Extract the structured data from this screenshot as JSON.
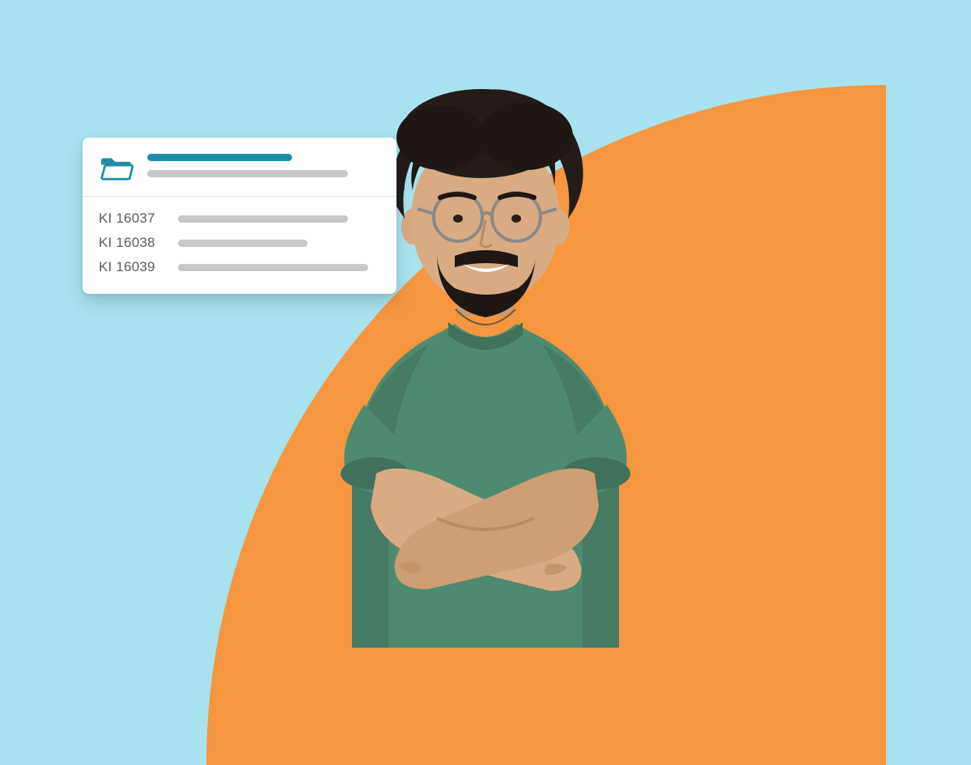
{
  "card": {
    "rows": [
      {
        "id": "KI 16037"
      },
      {
        "id": "KI 16038"
      },
      {
        "id": "KI 16039"
      }
    ]
  },
  "colors": {
    "background": "#A8E2EE",
    "accent_orange": "#F6963F",
    "folder_teal": "#1E8CA8",
    "placeholder_grey": "#C8C8C8",
    "shirt_green": "#4E8A6F"
  },
  "icons": {
    "folder": "folder-open-icon"
  }
}
